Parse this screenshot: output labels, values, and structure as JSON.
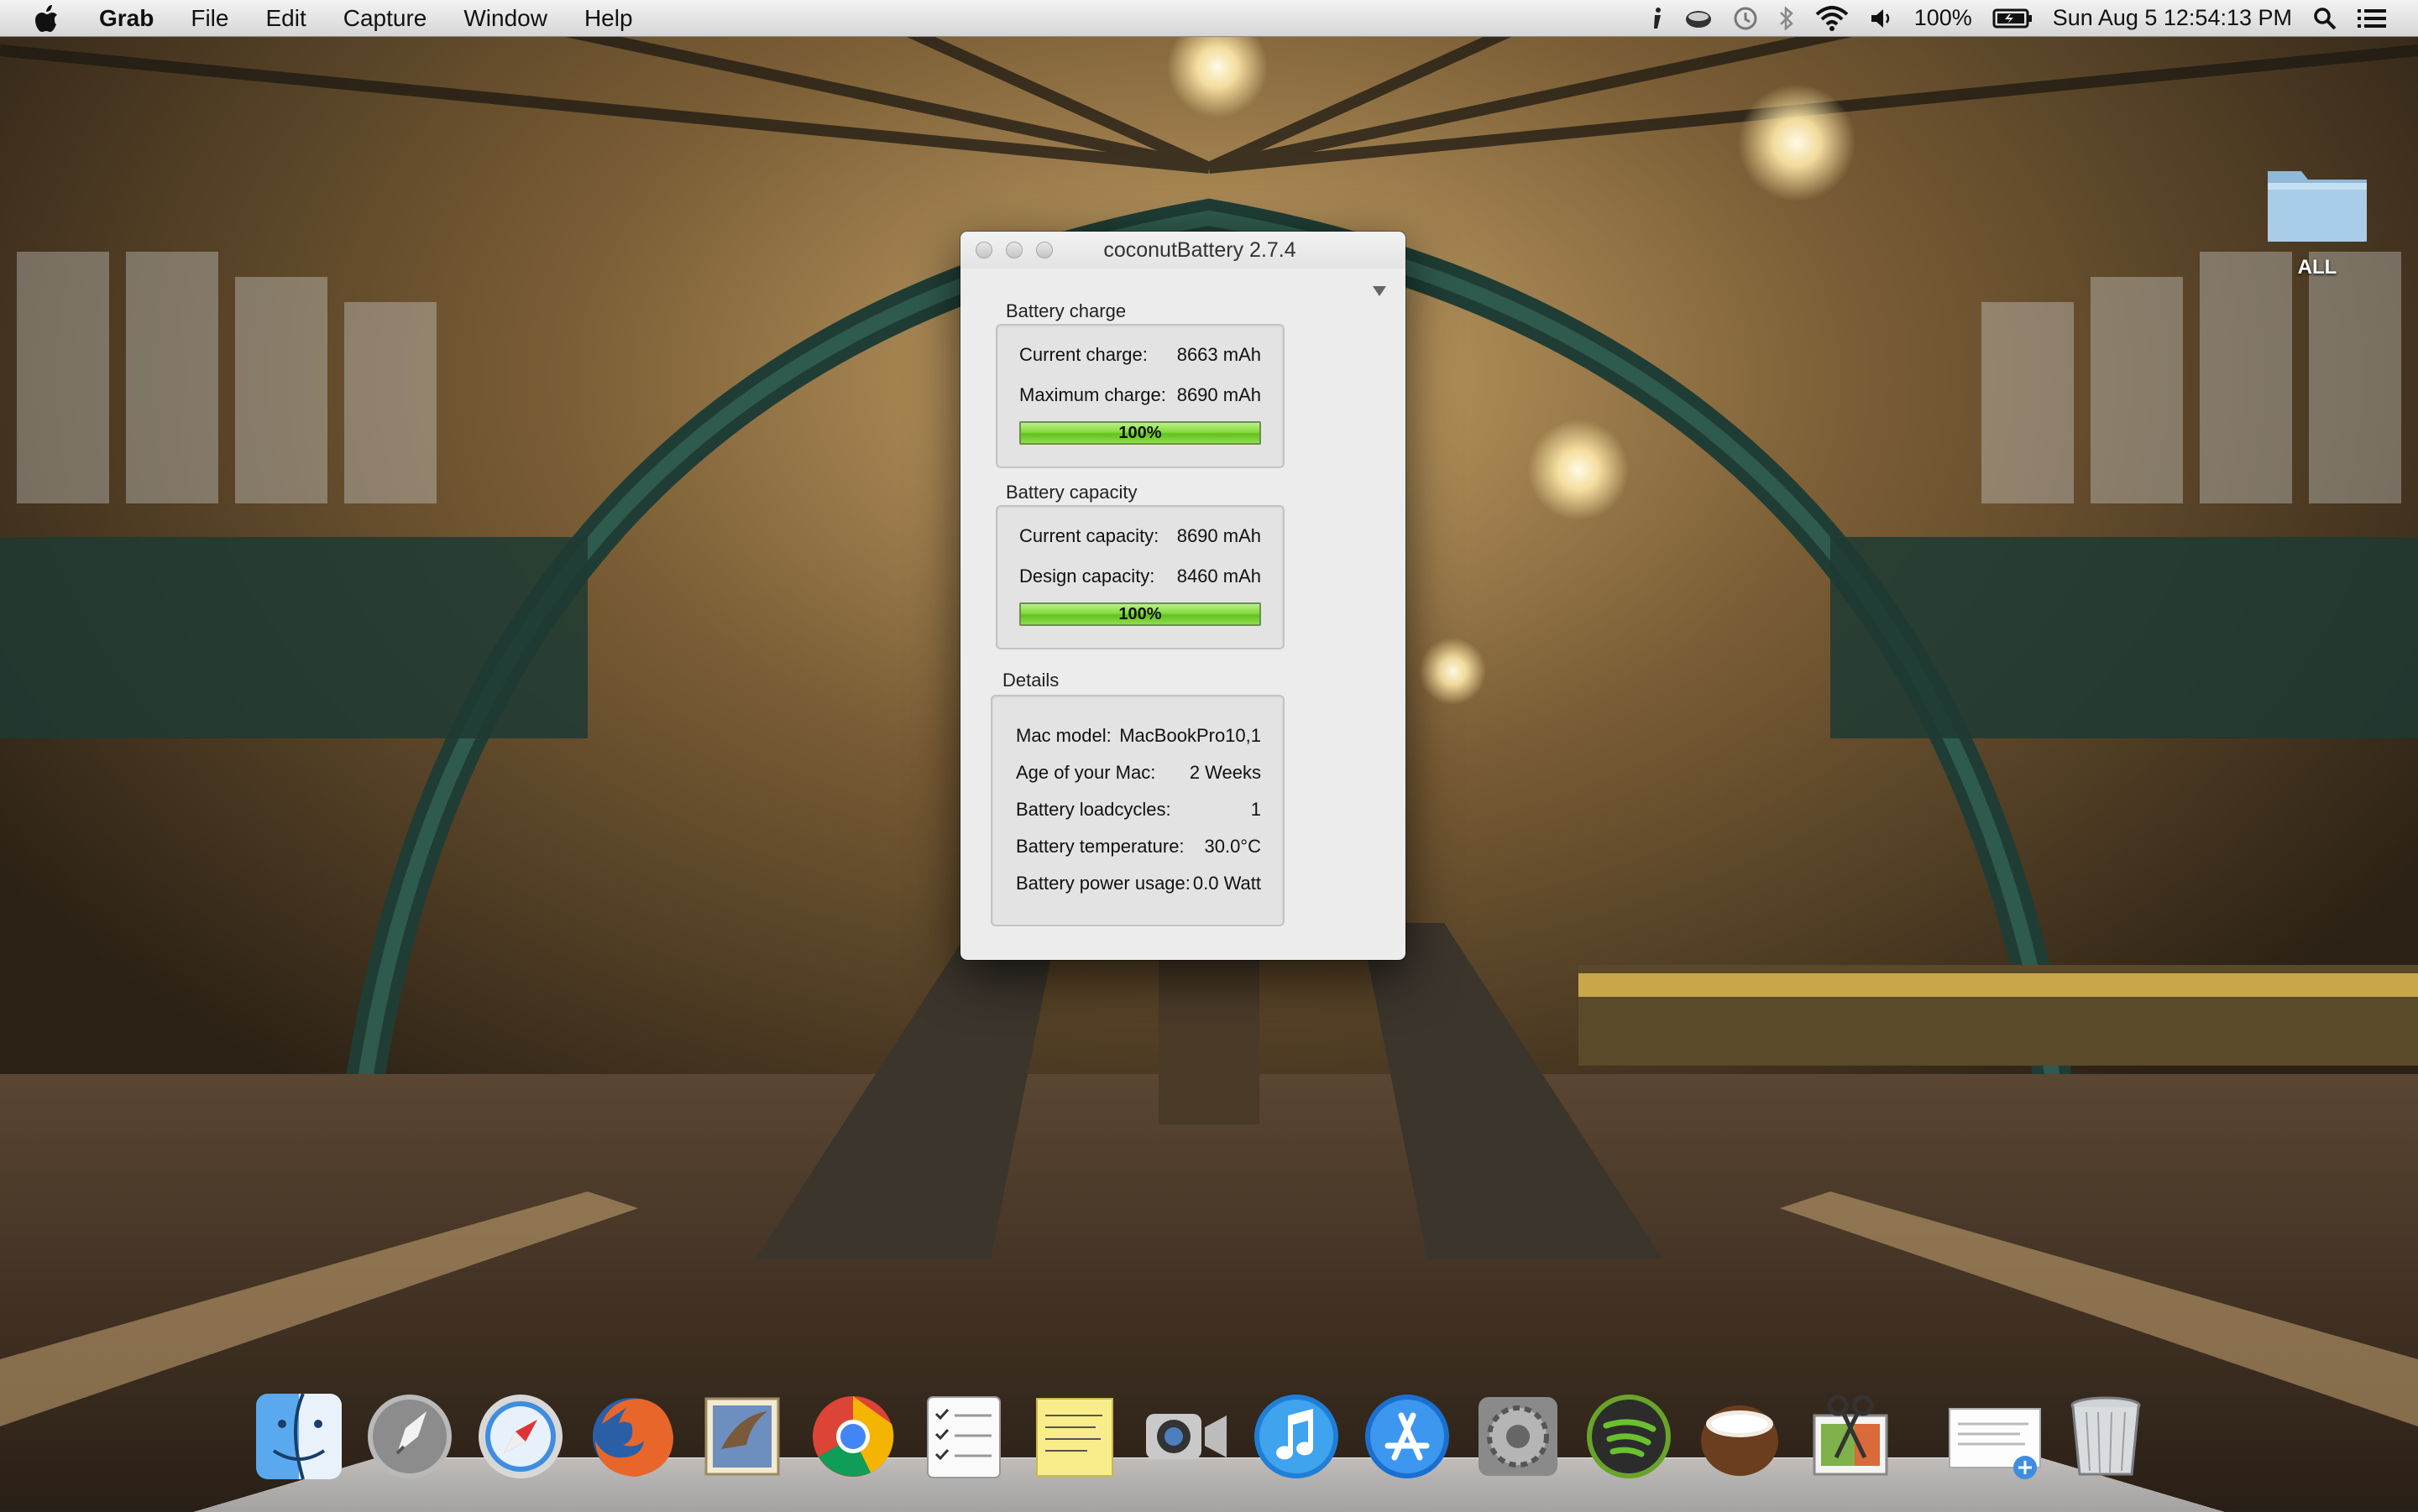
{
  "menubar": {
    "app_name": "Grab",
    "menus": [
      "File",
      "Edit",
      "Capture",
      "Window",
      "Help"
    ],
    "battery_percent": "100%",
    "datetime": "Sun Aug 5  12:54:13 PM"
  },
  "desktop": {
    "folder_label": "ALL"
  },
  "window": {
    "title": "coconutBattery 2.7.4",
    "battery_charge": {
      "heading": "Battery charge",
      "current_label": "Current charge:",
      "current_value": "8663 mAh",
      "maximum_label": "Maximum charge:",
      "maximum_value": "8690 mAh",
      "bar_text": "100%",
      "bar_level": 1.0
    },
    "battery_capacity": {
      "heading": "Battery capacity",
      "current_label": "Current capacity:",
      "current_value": "8690 mAh",
      "design_label": "Design capacity:",
      "design_value": "8460 mAh",
      "bar_text": "100%",
      "bar_level": 1.0
    },
    "details": {
      "heading": "Details",
      "rows": [
        {
          "label": "Mac model:",
          "value": "MacBookPro10,1"
        },
        {
          "label": "Age of your Mac:",
          "value": "2 Weeks"
        },
        {
          "label": "Battery loadcycles:",
          "value": "1"
        },
        {
          "label": "Battery temperature:",
          "value": "30.0°C"
        },
        {
          "label": "Battery power usage:",
          "value": "0.0 Watt"
        }
      ]
    }
  },
  "dock": {
    "apps": [
      "finder-icon",
      "launchpad-icon",
      "safari-icon",
      "firefox-icon",
      "mail-icon",
      "chrome-icon",
      "reminders-icon",
      "stickies-icon",
      "facetime-icon",
      "itunes-icon",
      "app-store-icon",
      "system-preferences-icon",
      "spotify-icon",
      "coconutbattery-icon",
      "grab-icon"
    ],
    "extras": [
      "downloads-stack-icon",
      "trash-icon"
    ]
  }
}
